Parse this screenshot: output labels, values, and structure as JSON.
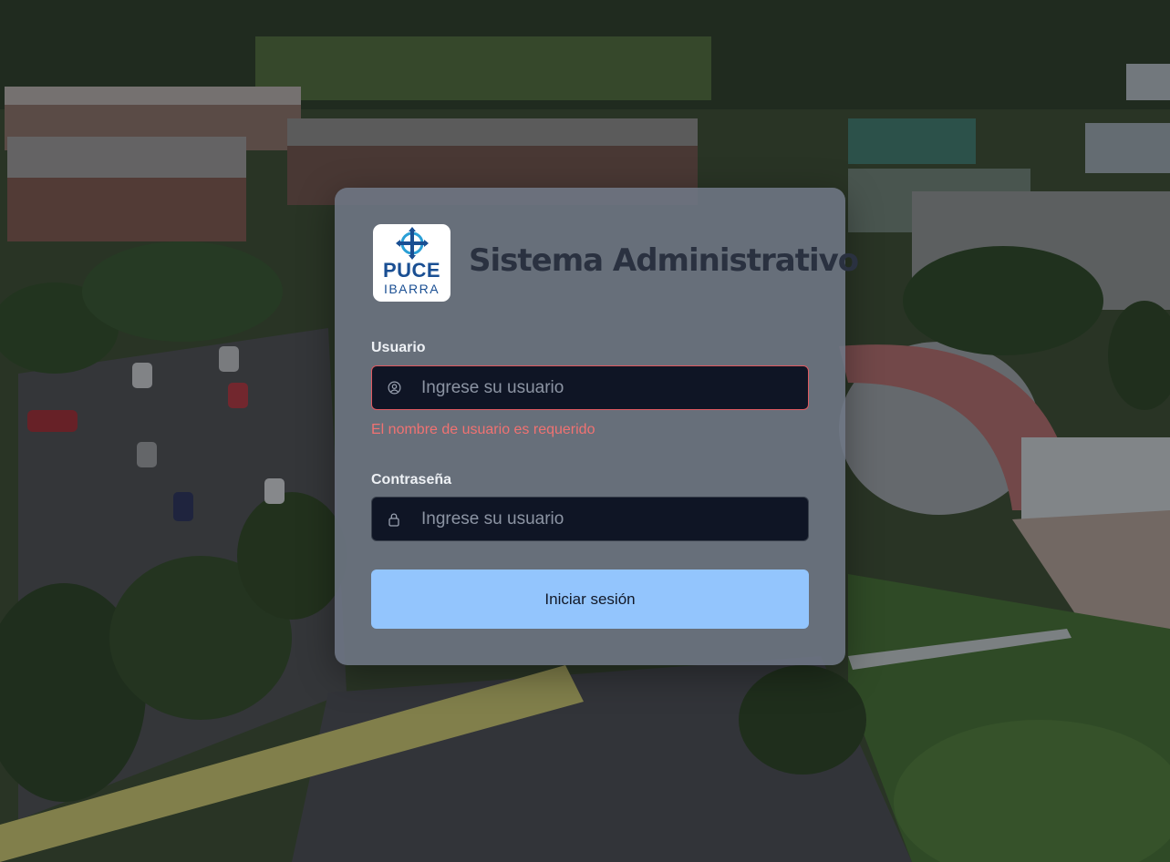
{
  "brand": {
    "logo_main": "PUCE",
    "logo_sub": "IBARRA"
  },
  "title": "Sistema Administrativo",
  "form": {
    "username": {
      "label": "Usuario",
      "placeholder": "Ingrese su usuario",
      "value": "",
      "icon": "user-circle-icon",
      "error": "El nombre de usuario es requerido"
    },
    "password": {
      "label": "Contraseña",
      "placeholder": "Ingrese su usuario",
      "value": "",
      "icon": "lock-icon"
    },
    "submit_label": "Iniciar sesión"
  },
  "colors": {
    "submit_bg": "#93c5fd",
    "error": "#f07272",
    "input_bg": "#0f1525",
    "logo_blue": "#1a4f93",
    "logo_cyan": "#2a9fd6"
  }
}
